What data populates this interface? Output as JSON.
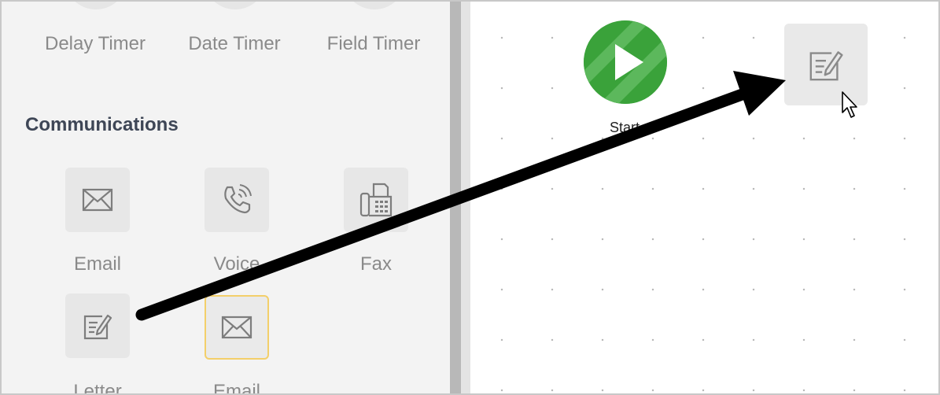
{
  "timers": {
    "delay_label": "Delay Timer",
    "date_label": "Date Timer",
    "field_label": "Field Timer"
  },
  "communications": {
    "title": "Communications",
    "items": [
      {
        "label": "Email",
        "icon": "envelope-icon"
      },
      {
        "label": "Voice",
        "icon": "phone-icon"
      },
      {
        "label": "Fax",
        "icon": "fax-icon"
      },
      {
        "label": "Letter",
        "icon": "letter-icon"
      },
      {
        "label": "Email",
        "icon": "envelope-icon",
        "selected": true
      }
    ]
  },
  "canvas": {
    "start_label": "Start",
    "dropped_node_icon": "letter-icon"
  },
  "colors": {
    "start_green": "#3aa23a",
    "selected_border": "#f3cf6a",
    "arrow": "#000000"
  }
}
